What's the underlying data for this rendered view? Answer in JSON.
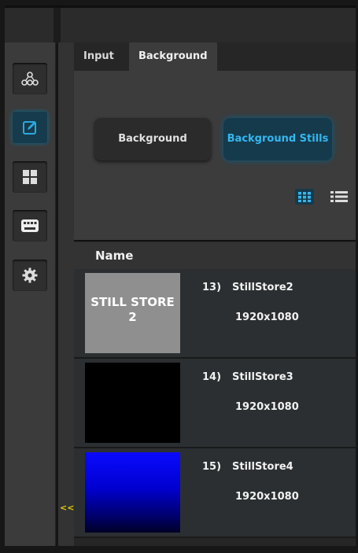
{
  "colors": {
    "accent": "#34b7ee",
    "activeBg": "#153a4c",
    "collapse": "#e6d000"
  },
  "nav": [
    {
      "icon": "network-icon"
    },
    {
      "icon": "edit-icon",
      "active": true
    },
    {
      "icon": "grid-icon"
    },
    {
      "icon": "keyboard-icon"
    },
    {
      "icon": "gear-icon"
    }
  ],
  "collapse_label": "<<",
  "tabs": [
    {
      "label": "Input"
    },
    {
      "label": "Background",
      "active": true
    }
  ],
  "segments": {
    "background": "Background",
    "stills": "Background Stills",
    "selected": "Background Stills"
  },
  "view_modes": {
    "grid_icon": "grid-view-icon",
    "list_icon": "list-view-icon",
    "selected": "grid"
  },
  "list": {
    "header": "Name",
    "items": [
      {
        "index": "13)",
        "name": "StillStore2",
        "resolution": "1920x1080",
        "thumb_text_line1": "STILL STORE",
        "thumb_text_line2": "2",
        "thumb_style": "gray"
      },
      {
        "index": "14)",
        "name": "StillStore3",
        "resolution": "1920x1080",
        "thumb_style": "black"
      },
      {
        "index": "15)",
        "name": "StillStore4",
        "resolution": "1920x1080",
        "thumb_style": "blue-gradient"
      }
    ]
  }
}
